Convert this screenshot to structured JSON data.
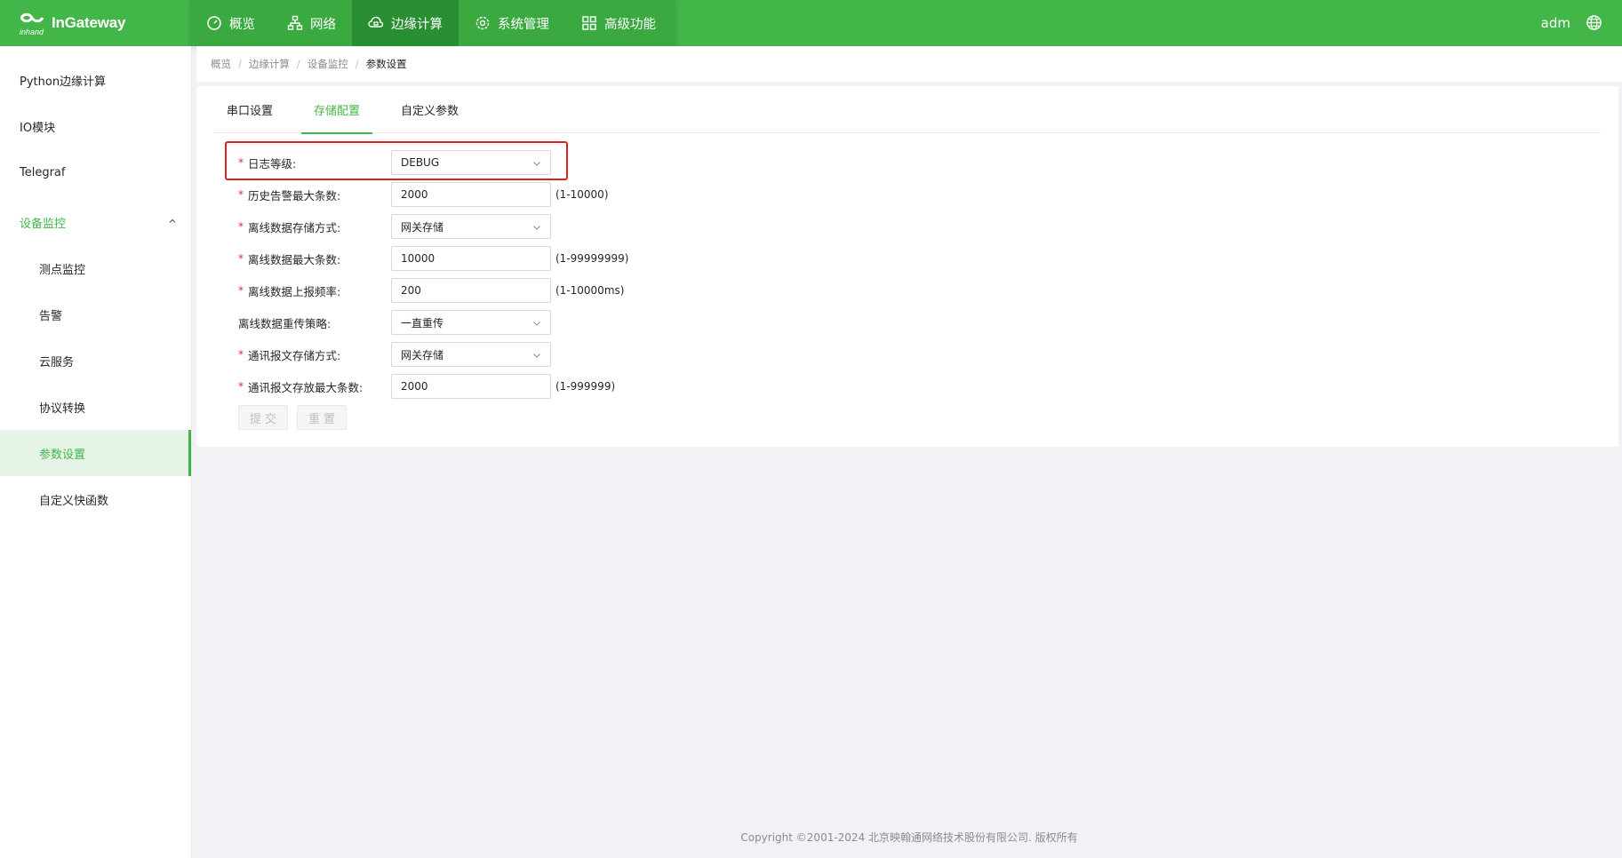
{
  "brand": {
    "name": "InGateway",
    "accent": "#43b649",
    "alert": "#e02020"
  },
  "nav": {
    "items": [
      {
        "label": "概览",
        "icon": "dashboard-icon"
      },
      {
        "label": "网络",
        "icon": "network-icon"
      },
      {
        "label": "边缘计算",
        "icon": "edge-cloud-icon",
        "active": true
      },
      {
        "label": "系统管理",
        "icon": "gear-icon"
      },
      {
        "label": "高级功能",
        "icon": "grid-icon"
      }
    ],
    "user": "adm"
  },
  "sidebar": {
    "items": [
      {
        "label": "Python边缘计算"
      },
      {
        "label": "IO模块"
      },
      {
        "label": "Telegraf"
      },
      {
        "label": "设备监控",
        "expanded": true
      },
      {
        "label": "测点监控"
      },
      {
        "label": "告警"
      },
      {
        "label": "云服务"
      },
      {
        "label": "协议转换"
      },
      {
        "label": "参数设置",
        "active": true
      },
      {
        "label": "自定义快函数"
      }
    ]
  },
  "breadcrumb": [
    "概览",
    "边缘计算",
    "设备监控",
    "参数设置"
  ],
  "tabs": [
    {
      "label": "串口设置"
    },
    {
      "label": "存储配置",
      "active": true
    },
    {
      "label": "自定义参数"
    }
  ],
  "form": {
    "fields": [
      {
        "label": "日志等级:",
        "required": true,
        "type": "select",
        "value": "DEBUG",
        "hint": ""
      },
      {
        "label": "历史告警最大条数:",
        "required": true,
        "type": "input",
        "value": "2000",
        "hint": "(1-10000)"
      },
      {
        "label": "离线数据存储方式:",
        "required": true,
        "type": "select",
        "value": "网关存储",
        "hint": ""
      },
      {
        "label": "离线数据最大条数:",
        "required": true,
        "type": "input",
        "value": "10000",
        "hint": "(1-99999999)"
      },
      {
        "label": "离线数据上报频率:",
        "required": true,
        "type": "input",
        "value": "200",
        "hint": "(1-10000ms)"
      },
      {
        "label": "离线数据重传策略:",
        "required": false,
        "type": "select",
        "value": "一直重传",
        "hint": ""
      },
      {
        "label": "通讯报文存储方式:",
        "required": true,
        "type": "select",
        "value": "网关存储",
        "hint": ""
      },
      {
        "label": "通讯报文存放最大条数:",
        "required": true,
        "type": "input",
        "value": "2000",
        "hint": "(1-999999)"
      }
    ],
    "submit_label": "提 交",
    "reset_label": "重 置"
  },
  "footer": "Copyright ©2001-2024 北京映翰通网络技术股份有限公司. 版权所有"
}
